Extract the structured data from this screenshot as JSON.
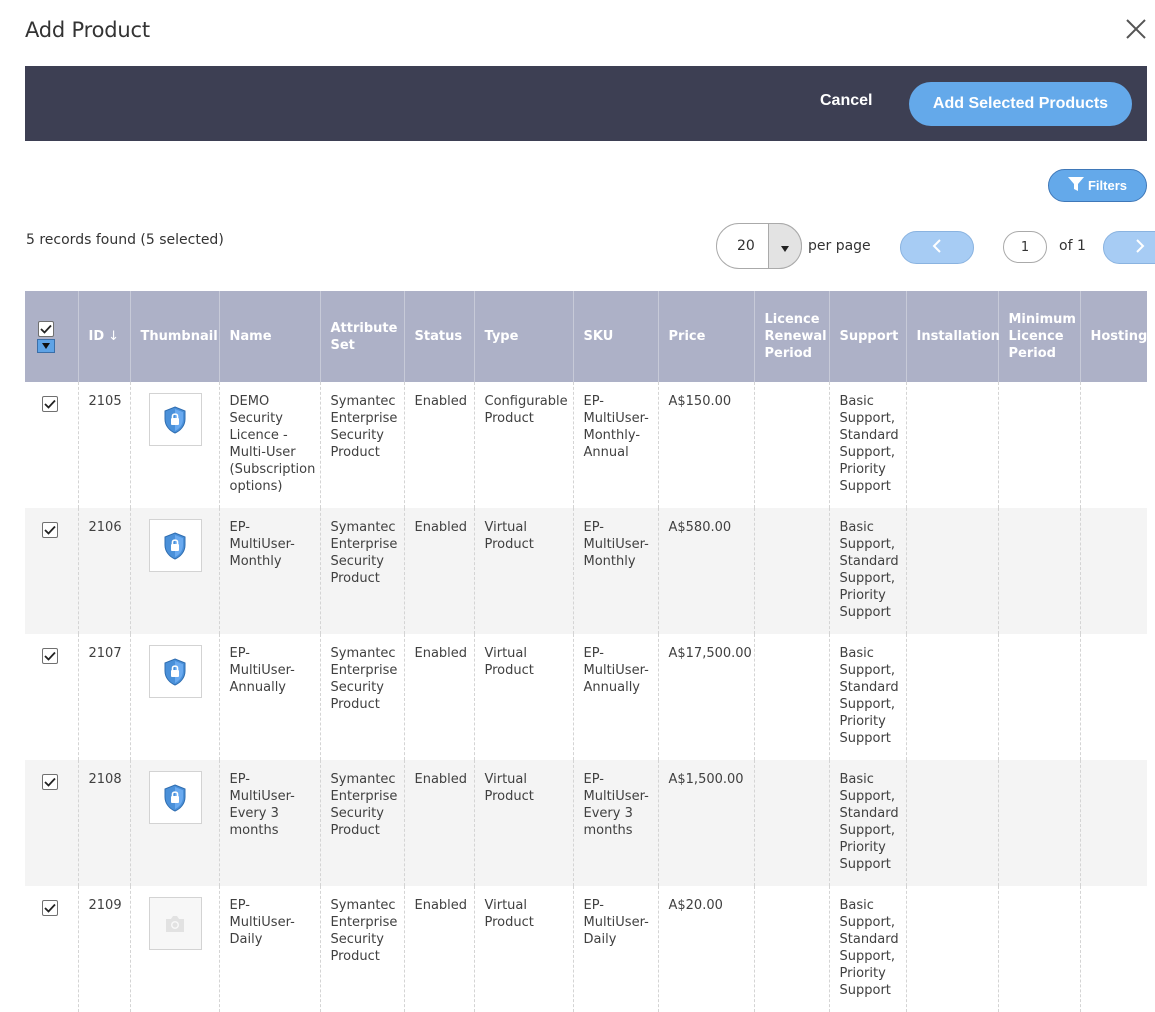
{
  "modal": {
    "title": "Add Product",
    "close_icon": "close-icon"
  },
  "actions": {
    "cancel_label": "Cancel",
    "add_label": "Add Selected Products"
  },
  "filters": {
    "label": "Filters",
    "icon": "filter-icon"
  },
  "records": {
    "summary": "5 records found (5 selected)"
  },
  "pager": {
    "per_page_value": "20",
    "per_page_label": "per page",
    "current_page": "1",
    "of_label": "of 1"
  },
  "columns": {
    "id": "ID",
    "thumbnail": "Thumbnail",
    "name": "Name",
    "attribute_set": "Attribute Set",
    "status": "Status",
    "type": "Type",
    "sku": "SKU",
    "price": "Price",
    "licence_renewal": "Licence Renewal Period",
    "support": "Support",
    "installation": "Installation",
    "min_licence": "Minimum Licence Period",
    "hosting": "Hosting"
  },
  "rows": [
    {
      "id": "2105",
      "name": "DEMO Security Licence - Multi-User (Subscription options)",
      "attribute_set": "Symantec Enterprise Security Product",
      "status": "Enabled",
      "type": "Configurable Product",
      "sku": "EP-MultiUser-Monthly-Annual",
      "price": "A$150.00",
      "licence_renewal": "",
      "support": "Basic Support, Standard Support, Priority Support",
      "installation": "",
      "min_licence": "",
      "hosting": "",
      "thumbnail": "shield-lock-icon"
    },
    {
      "id": "2106",
      "name": "EP-MultiUser-Monthly",
      "attribute_set": "Symantec Enterprise Security Product",
      "status": "Enabled",
      "type": "Virtual Product",
      "sku": "EP-MultiUser-Monthly",
      "price": "A$580.00",
      "licence_renewal": "",
      "support": "Basic Support, Standard Support, Priority Support",
      "installation": "",
      "min_licence": "",
      "hosting": "",
      "thumbnail": "shield-lock-icon"
    },
    {
      "id": "2107",
      "name": "EP-MultiUser-Annually",
      "attribute_set": "Symantec Enterprise Security Product",
      "status": "Enabled",
      "type": "Virtual Product",
      "sku": "EP-MultiUser-Annually",
      "price": "A$17,500.00",
      "licence_renewal": "",
      "support": "Basic Support, Standard Support, Priority Support",
      "installation": "",
      "min_licence": "",
      "hosting": "",
      "thumbnail": "shield-lock-icon"
    },
    {
      "id": "2108",
      "name": "EP-MultiUser-Every 3 months",
      "attribute_set": "Symantec Enterprise Security Product",
      "status": "Enabled",
      "type": "Virtual Product",
      "sku": "EP-MultiUser-Every 3 months",
      "price": "A$1,500.00",
      "licence_renewal": "",
      "support": "Basic Support, Standard Support, Priority Support",
      "installation": "",
      "min_licence": "",
      "hosting": "",
      "thumbnail": "shield-lock-icon"
    },
    {
      "id": "2109",
      "name": "EP-MultiUser-Daily",
      "attribute_set": "Symantec Enterprise Security Product",
      "status": "Enabled",
      "type": "Virtual Product",
      "sku": "EP-MultiUser-Daily",
      "price": "A$20.00",
      "licence_renewal": "",
      "support": "Basic Support, Standard Support, Priority Support",
      "installation": "",
      "min_licence": "",
      "hosting": "",
      "thumbnail": "camera-placeholder-icon"
    }
  ],
  "colors": {
    "action_bar": "#3d3f53",
    "accent": "#64a9ea",
    "header": "#adb1c7",
    "pager_disabled": "#a7ccf4"
  }
}
